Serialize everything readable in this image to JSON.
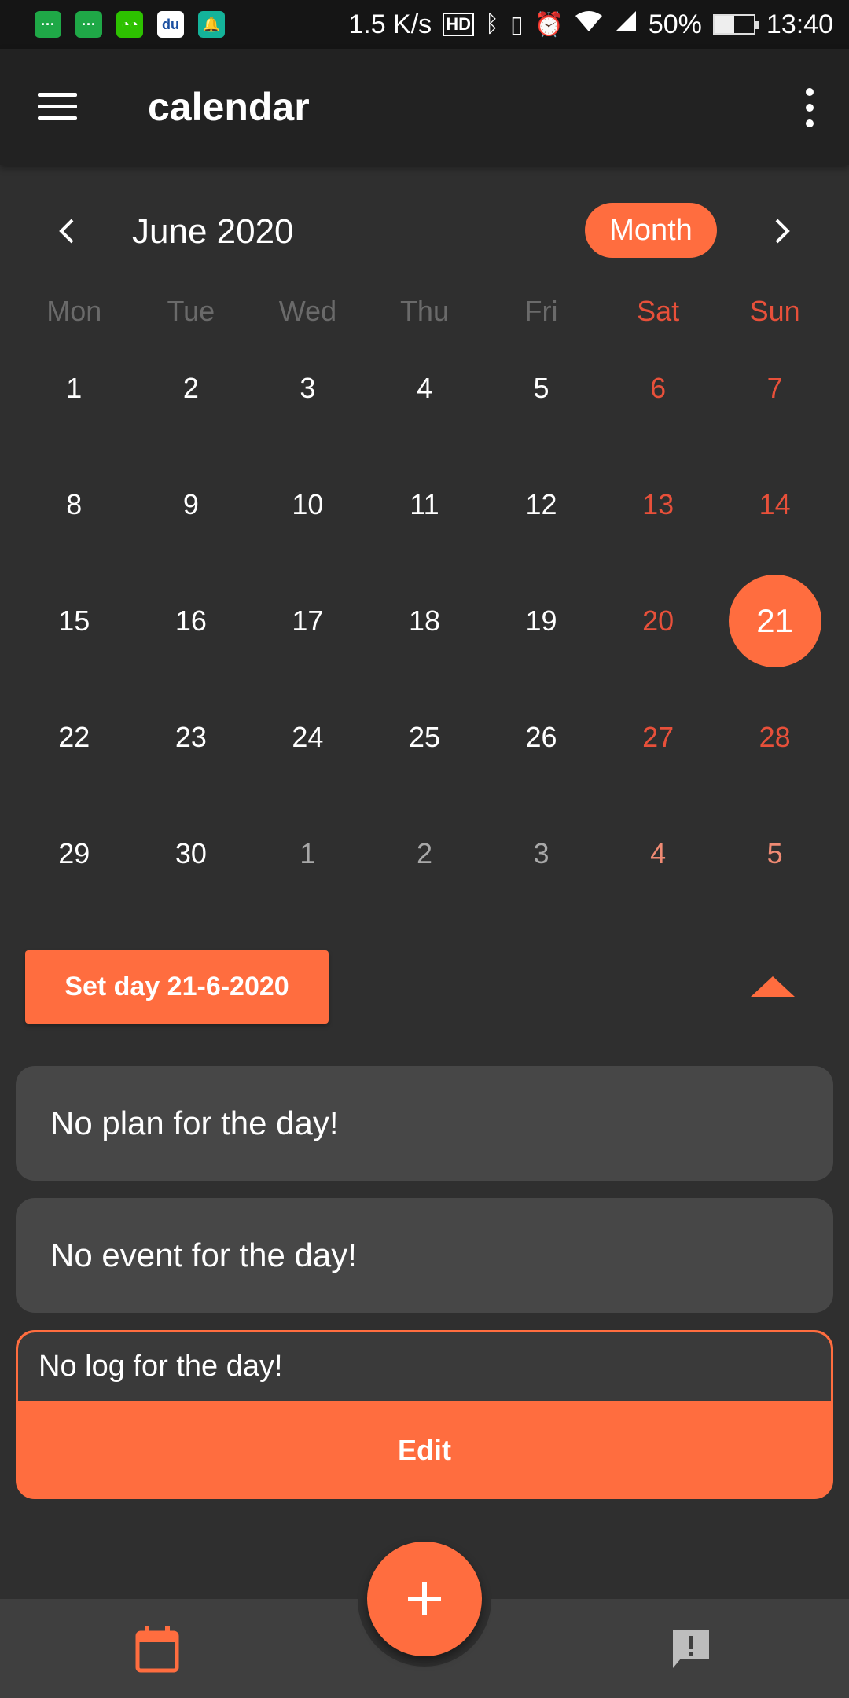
{
  "status_bar": {
    "speed": "1.5 K/s",
    "battery_pct": "50%",
    "battery_level": 0.5,
    "time": "13:40",
    "hd_label": "HD",
    "notification_icons": [
      "green-chat-icon",
      "green-chat-icon",
      "wechat-icon",
      "app-icon",
      "bell-icon"
    ]
  },
  "appbar": {
    "title": "calendar"
  },
  "calendar": {
    "month_label": "June 2020",
    "view_mode": "Month",
    "weekdays": [
      "Mon",
      "Tue",
      "Wed",
      "Thu",
      "Fri",
      "Sat",
      "Sun"
    ],
    "weeks": [
      [
        {
          "d": "1"
        },
        {
          "d": "2"
        },
        {
          "d": "3"
        },
        {
          "d": "4"
        },
        {
          "d": "5"
        },
        {
          "d": "6",
          "we": true
        },
        {
          "d": "7",
          "we": true
        }
      ],
      [
        {
          "d": "8"
        },
        {
          "d": "9"
        },
        {
          "d": "10"
        },
        {
          "d": "11"
        },
        {
          "d": "12"
        },
        {
          "d": "13",
          "we": true
        },
        {
          "d": "14",
          "we": true
        }
      ],
      [
        {
          "d": "15"
        },
        {
          "d": "16"
        },
        {
          "d": "17"
        },
        {
          "d": "18"
        },
        {
          "d": "19"
        },
        {
          "d": "20",
          "we": true
        },
        {
          "d": "21",
          "we": true,
          "sel": true
        }
      ],
      [
        {
          "d": "22"
        },
        {
          "d": "23"
        },
        {
          "d": "24"
        },
        {
          "d": "25"
        },
        {
          "d": "26"
        },
        {
          "d": "27",
          "we": true
        },
        {
          "d": "28",
          "we": true
        }
      ],
      [
        {
          "d": "29"
        },
        {
          "d": "30"
        },
        {
          "d": "1",
          "other": true
        },
        {
          "d": "2",
          "other": true
        },
        {
          "d": "3",
          "other": true
        },
        {
          "d": "4",
          "we": true,
          "other": true
        },
        {
          "d": "5",
          "we": true,
          "other": true
        }
      ]
    ]
  },
  "day_panel": {
    "set_day_label": "Set day 21-6-2020",
    "plan_text": "No plan for the day!",
    "event_text": "No event for the day!",
    "log_text": "No log for the day!",
    "edit_label": "Edit"
  },
  "colors": {
    "accent": "#ff6d3f",
    "weekend": "#e8503a",
    "background": "#2f2f2f",
    "appbar": "#222222",
    "card": "#474747"
  }
}
